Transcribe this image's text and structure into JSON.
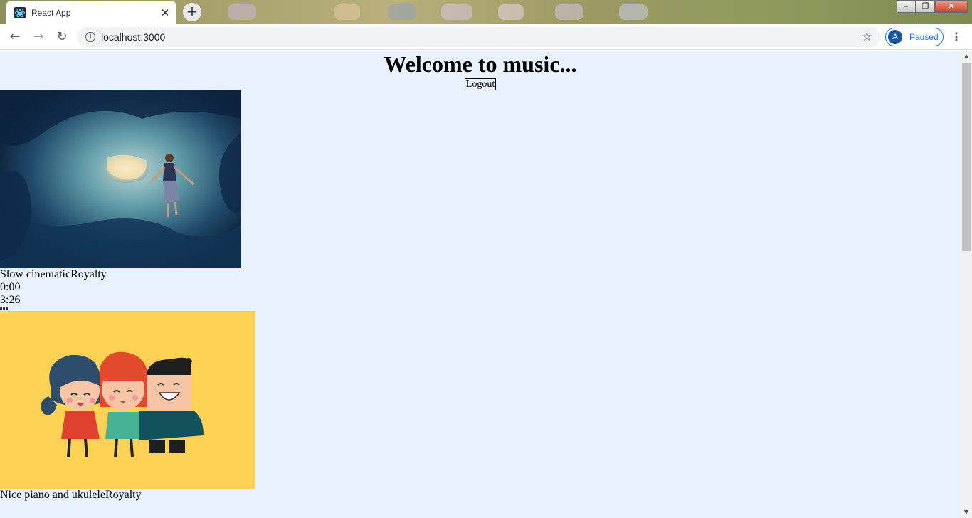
{
  "browser": {
    "tab_title": "React App",
    "tab_close": "✕",
    "new_tab": "+",
    "url": "localhost:3000",
    "profile_initial": "A",
    "profile_status": "Paused",
    "window_controls": {
      "minimize": "–",
      "restore": "❐",
      "close": "✕"
    },
    "nav": {
      "back": "←",
      "forward": "→",
      "reload": "↻"
    },
    "bookmark_star": "☆",
    "menu": "⋮",
    "info": "i"
  },
  "page": {
    "title": "Welcome to music...",
    "logout_label": "Logout",
    "songs": [
      {
        "name": "Slow cinematic",
        "tag": "Royalty",
        "current_time": "0:00",
        "duration": "3:26",
        "cover_icon": "cave-explorer-artwork"
      },
      {
        "name": "Nice piano and ukulele",
        "tag": "Royalty",
        "cover_icon": "three-friends-cartoon-artwork"
      }
    ]
  },
  "colors": {
    "page_background": "#e8f1fe",
    "profile_accent": "#1a73e8",
    "second_cover_background": "#fed255"
  }
}
